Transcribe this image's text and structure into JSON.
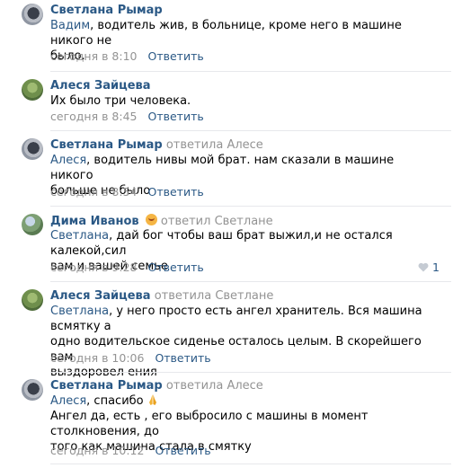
{
  "comments": [
    {
      "author": "Светлана Рымар",
      "reply_to": "",
      "addressee": "Вадим",
      "body_lines": [
        ", водитель жив, в больнице, кроме него в машине никого не",
        "было."
      ],
      "date": "сегодня в 8:10",
      "reply_label": "Ответить"
    },
    {
      "author": "Алеся Зайцева",
      "reply_to": "",
      "addressee": "",
      "body_lines": [
        "Их было три человека."
      ],
      "date": "сегодня в 8:45",
      "reply_label": "Ответить"
    },
    {
      "author": "Светлана Рымар",
      "reply_to": "ответила Алесе",
      "addressee": "Алеся",
      "body_lines": [
        ", водитель нивы мой брат. нам сказали в машине никого",
        "больше не было"
      ],
      "date": "сегодня в 8:54",
      "reply_label": "Ответить"
    },
    {
      "author": "Дима Иванов",
      "reply_to": "ответил Светлане",
      "addressee": "Светлана",
      "body_lines": [
        ", дай бог чтобы ваш брат выжил,и не остался калекой,сил",
        "вам,и вашей семье"
      ],
      "date": "сегодня в 9:28",
      "reply_label": "Ответить",
      "likes": "1"
    },
    {
      "author": "Алеся Зайцева",
      "reply_to": "ответила Светлане",
      "addressee": "Светлана",
      "body_lines": [
        ", у него просто есть ангел хранитель. Вся машина всмятку а",
        "одно водительское сиденье осталось целым. В скорейшего вам",
        "выздоровел ения"
      ],
      "date": "сегодня в 10:06",
      "reply_label": "Ответить"
    },
    {
      "author": "Светлана Рымар",
      "reply_to": "ответила Алесе",
      "addressee": "Алеся",
      "body_lines": [
        ", спасибо",
        "Ангел да, есть , его выбросило с машины в момент столкновения, до",
        "того как машина стала в смятку"
      ],
      "date": "сегодня в 10:12",
      "reply_label": "Ответить"
    }
  ],
  "colors": {
    "link": "#2a5885",
    "muted": "#939393",
    "divider": "#e7e8ec"
  }
}
